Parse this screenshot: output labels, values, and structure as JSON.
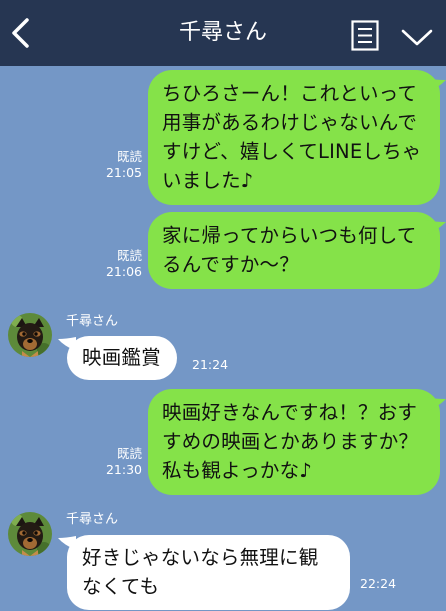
{
  "header": {
    "title": "千尋さん"
  },
  "messages": [
    {
      "side": "sent",
      "text": "ちひろさーん！これといって用事があるわけじゃないんですけど、嬉しくてLINEしちゃいました♪",
      "read": "既読",
      "time": "21:05"
    },
    {
      "side": "sent",
      "text": "家に帰ってからいつも何してるんですか〜？",
      "read": "既読",
      "time": "21:06"
    },
    {
      "side": "received",
      "sender": "千尋さん",
      "text": "映画鑑賞",
      "time": "21:24"
    },
    {
      "side": "sent",
      "text": "映画好きなんですね！？おすすめの映画とかありますか？私も観よっかな♪",
      "read": "既読",
      "time": "21:30"
    },
    {
      "side": "received",
      "sender": "千尋さん",
      "text": "好きじゃないなら無理に観なくても",
      "time": "22:24"
    }
  ],
  "colors": {
    "header_bg": "#263652",
    "chat_bg": "#7497c6",
    "sent_bubble": "#85e249",
    "received_bubble": "#ffffff"
  },
  "icons": [
    "back-arrow-icon",
    "menu-list-icon",
    "chevron-down-icon",
    "dog-avatar"
  ]
}
